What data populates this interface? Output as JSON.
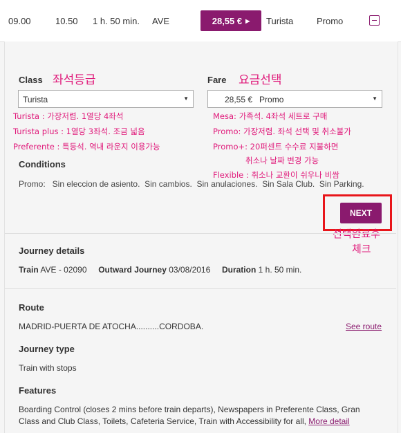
{
  "train_row": {
    "depart": "09.00",
    "arrive": "10.50",
    "duration": "1 h. 50 min.",
    "train_type": "AVE",
    "price": "28,55 €",
    "class": "Turista",
    "fare": "Promo"
  },
  "selection": {
    "class_label": "Class",
    "class_value": "Turista",
    "fare_label": "Fare",
    "fare_value": "28,55 €   Promo"
  },
  "annotations": {
    "class_title": "좌석등급",
    "fare_title": "요금선택",
    "class_notes": [
      "Turista : 가장저렴. 1열당 4좌석",
      "Turista plus : 1열당 3좌석. 조금 넓음",
      "Preferente : 특등석. 역내 라운지 이용가능"
    ],
    "fare_notes": [
      "Mesa: 가족석. 4좌석 세트로 구매",
      "Promo: 가장저렴. 좌석 선택 및 취소불가",
      "Promo+: 20퍼센트 수수료 지불하면",
      "취소나 날짜 변경 가능",
      "Flexible : 취소나 교환이 쉬우나 비쌈"
    ],
    "next_note_line1": "선택완료후",
    "next_note_line2": "체크"
  },
  "conditions": {
    "title": "Conditions",
    "text": "Promo:   Sin eleccion de asiento.  Sin cambios.  Sin anulaciones.  Sin Sala Club.  Sin Parking."
  },
  "next_label": "NEXT",
  "journey": {
    "title": "Journey details",
    "train_label": "Train",
    "train_value": "AVE - 02090",
    "outward_label": "Outward Journey",
    "outward_value": "03/08/2016",
    "duration_label": "Duration",
    "duration_value": "1 h. 50 min."
  },
  "route": {
    "title": "Route",
    "text": "MADRID-PUERTA DE ATOCHA..........CORDOBA.",
    "link": "See route"
  },
  "journey_type": {
    "title": "Journey type",
    "text": "Train with stops"
  },
  "features": {
    "title": "Features",
    "line1": "Boarding Control (closes 2 mins before train departs), Newspapers in Preferente Class, Gran",
    "line2": "Class and Club Class, Toilets, Cafeteria Service, Train with Accessibility for all,",
    "more_link": "More detail"
  },
  "colors": {
    "accent": "#8a1a6e",
    "annotation": "#e0197a",
    "highlight_box": "#e8151a"
  }
}
